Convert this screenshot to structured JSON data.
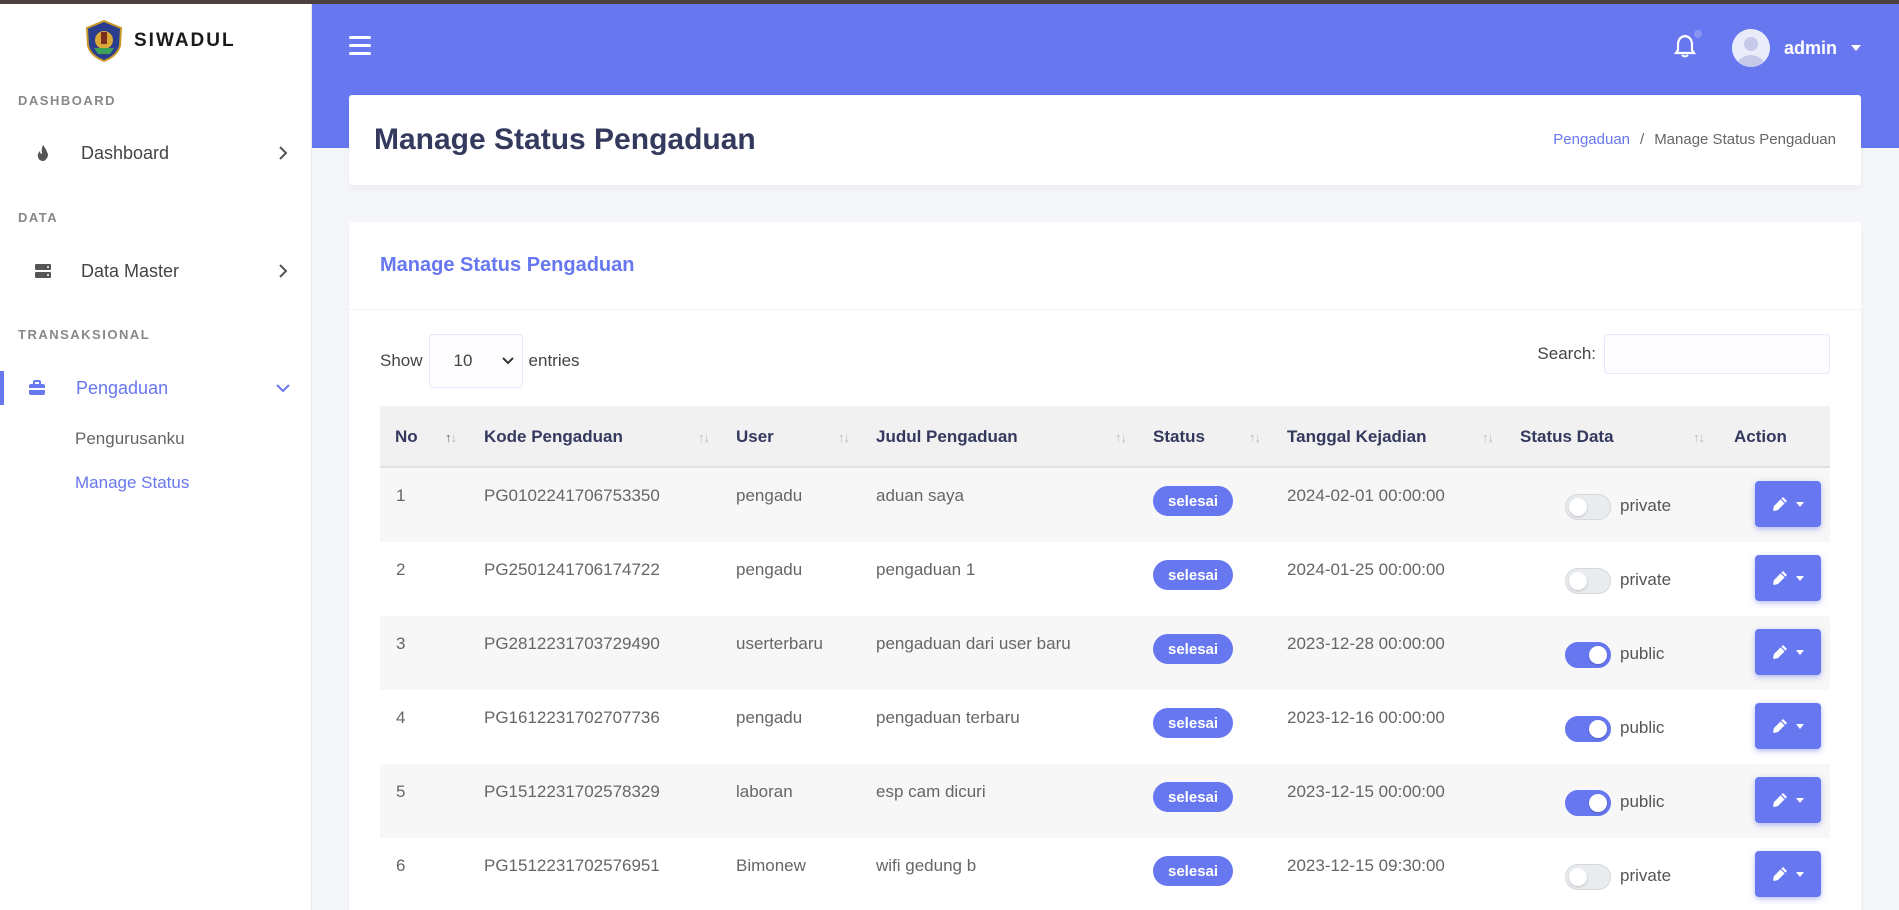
{
  "brand": {
    "name": "SIWADUL"
  },
  "sidebar": {
    "sections": [
      {
        "header": "DASHBOARD",
        "items": [
          {
            "label": "Dashboard",
            "icon": "fire-icon"
          }
        ]
      },
      {
        "header": "DATA",
        "items": [
          {
            "label": "Data Master",
            "icon": "server-icon"
          }
        ]
      },
      {
        "header": "TRANSAKSIONAL",
        "items": [
          {
            "label": "Pengaduan",
            "icon": "briefcase-icon",
            "active": true,
            "subitems": [
              {
                "label": "Pengurusanku"
              },
              {
                "label": "Manage Status",
                "current": true
              }
            ]
          }
        ]
      }
    ]
  },
  "navbar": {
    "user_name": "admin",
    "icons": [
      "hamburger-icon",
      "bell-icon"
    ]
  },
  "header": {
    "title": "Manage Status Pengaduan",
    "breadcrumb": {
      "link": "Pengaduan",
      "separator": "/",
      "current": "Manage Status Pengaduan"
    }
  },
  "card": {
    "title": "Manage Status Pengaduan",
    "show_label": "Show",
    "entries_value": "10",
    "entries_label": "entries",
    "search_label": "Search:",
    "search_value": ""
  },
  "table": {
    "columns": [
      "No",
      "Kode Pengaduan",
      "User",
      "Judul Pengaduan",
      "Status",
      "Tanggal Kejadian",
      "Status Data",
      "Action"
    ],
    "rows": [
      {
        "no": "1",
        "kode": "PG0102241706753350",
        "user": "pengadu",
        "judul": "aduan saya",
        "status": "selesai",
        "tanggal": "2024-02-01 00:00:00",
        "public": false,
        "status_data": "private"
      },
      {
        "no": "2",
        "kode": "PG2501241706174722",
        "user": "pengadu",
        "judul": "pengaduan 1",
        "status": "selesai",
        "tanggal": "2024-01-25 00:00:00",
        "public": false,
        "status_data": "private"
      },
      {
        "no": "3",
        "kode": "PG2812231703729490",
        "user": "userterbaru",
        "judul": "pengaduan dari user baru",
        "status": "selesai",
        "tanggal": "2023-12-28 00:00:00",
        "public": true,
        "status_data": "public"
      },
      {
        "no": "4",
        "kode": "PG1612231702707736",
        "user": "pengadu",
        "judul": "pengaduan terbaru",
        "status": "selesai",
        "tanggal": "2023-12-16 00:00:00",
        "public": true,
        "status_data": "public"
      },
      {
        "no": "5",
        "kode": "PG1512231702578329",
        "user": "laboran",
        "judul": "esp cam dicuri",
        "status": "selesai",
        "tanggal": "2023-12-15 00:00:00",
        "public": true,
        "status_data": "public"
      },
      {
        "no": "6",
        "kode": "PG1512231702576951",
        "user": "Bimonew",
        "judul": "wifi gedung b",
        "status": "selesai",
        "tanggal": "2023-12-15 09:30:00",
        "public": false,
        "status_data": "private"
      }
    ]
  },
  "colors": {
    "primary": "#6777ef",
    "text_dark": "#34395e",
    "row_stripe": "#f7f7f7"
  }
}
